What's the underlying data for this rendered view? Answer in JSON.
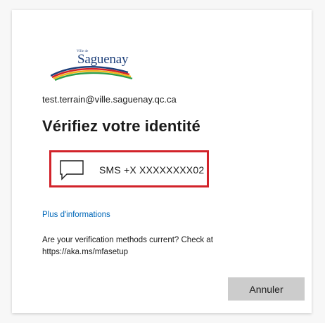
{
  "logo": {
    "small_text": "Ville de",
    "name": "Saguenay"
  },
  "account": {
    "email": "test.terrain@ville.saguenay.qc.ca"
  },
  "title": "Vérifiez votre identité",
  "methods": [
    {
      "icon": "chat-bubble-icon",
      "label": "SMS +X XXXXXXXX02"
    }
  ],
  "links": {
    "more_info": "Plus d'informations"
  },
  "info": {
    "check_text": "Are your verification methods current? Check at https://aka.ms/mfasetup"
  },
  "buttons": {
    "cancel": "Annuler"
  },
  "colors": {
    "highlight_border": "#d2232a",
    "link": "#0067b8",
    "button_bg": "#cccccc",
    "logo_blue": "#1d3f7a",
    "logo_red": "#d2232a",
    "logo_yellow": "#f2b51c",
    "logo_green": "#2f9e4a"
  }
}
